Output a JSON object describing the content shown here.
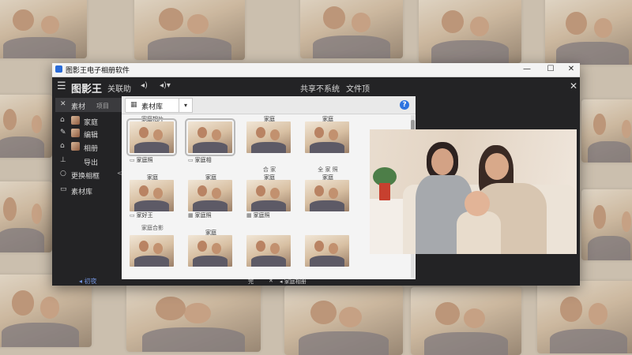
{
  "window": {
    "title": "图影王电子相册软件",
    "controls": {
      "minimize": "—",
      "maximize": "☐",
      "close": "✕"
    }
  },
  "header": {
    "menu_icon": "☰",
    "app_name": "图影王",
    "subtitle": "关联助",
    "volume_icon": "◂)",
    "speaker_icon": "◂)▾",
    "link1": "共享不系统",
    "link2": "文件顶",
    "close_icon": "✕"
  },
  "sidebar": {
    "items": [
      {
        "icon": "✕",
        "label": "素材",
        "extra": "项目"
      },
      {
        "icon": "⌂",
        "label": "家庭",
        "thumb": true
      },
      {
        "icon": "✎",
        "label": "编辑",
        "thumb": true
      },
      {
        "icon": "⌂",
        "label": "相册",
        "thumb": true
      },
      {
        "icon": "⊥",
        "label": "导出"
      },
      {
        "icon": "○",
        "label": "更换相框",
        "chevron": "<"
      },
      {
        "icon": "▭",
        "label": "素材库"
      }
    ],
    "footer": "◂ 初夜"
  },
  "browser": {
    "tab_label": "素材库",
    "tab_icon": "▦",
    "dropdown": "▾",
    "help_icon": "?",
    "thumbnails": [
      {
        "caption": "家庭相片",
        "label": "家庭照",
        "label_icon": "▭",
        "sel": true
      },
      {
        "caption": "",
        "label": "家庭相",
        "label_icon": "▭",
        "sel": true
      },
      {
        "caption": "家庭",
        "label": "",
        "sub": "合 家"
      },
      {
        "caption": "家庭",
        "label": "",
        "sub": "全 家 照"
      },
      {
        "caption": "家庭",
        "label": "",
        "sub": "家庭合影"
      },
      {
        "caption": "家庭",
        "label": "",
        "sub": ""
      },
      {
        "caption": "家庭",
        "label": "",
        "sub": ""
      },
      {
        "caption": "家庭",
        "label": "",
        "sub": ""
      },
      {
        "caption": "",
        "label": "家好王",
        "label_icon": "▭"
      },
      {
        "caption": "",
        "label": "家庭照",
        "label_icon": "▦"
      },
      {
        "caption": "",
        "label": "家庭照",
        "label_icon": "▦"
      },
      {
        "caption": "",
        "label": ""
      },
      {
        "caption": "家庭",
        "label": ""
      },
      {
        "caption": "",
        "label": ""
      },
      {
        "caption": "",
        "label": ""
      },
      {
        "caption": "",
        "label": ""
      }
    ]
  },
  "bottombar": {
    "left": "完",
    "mid": "✕",
    "right": "◂ 家庭相册"
  }
}
